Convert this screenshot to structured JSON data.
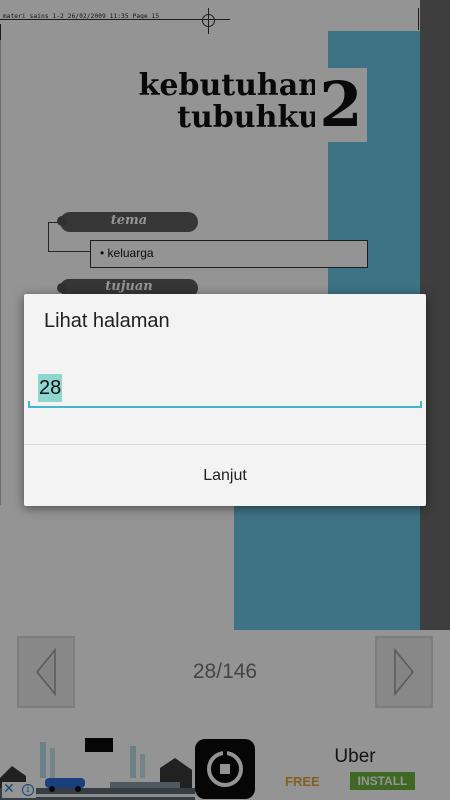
{
  "document": {
    "print_meta": "materi sains 1-2   26/02/2009   11:35   Page 15",
    "title_line1": "kebutuhan",
    "title_line2": "tubuhku",
    "chapter_number": "2",
    "tema_label": "tema",
    "topic_item": "keluarga",
    "tujuan_label": "tujuan",
    "accent_color": "#6cc6e6"
  },
  "navigation": {
    "page_counter": "28/146",
    "prev_icon": "chevron-left-icon",
    "next_icon": "chevron-right-icon"
  },
  "ad": {
    "title": "Uber",
    "free_label": "FREE",
    "install_label": "INSTALL",
    "logo_icon": "uber-logo-icon",
    "close_icon": "close-icon",
    "info_icon": "info-icon",
    "install_color": "#6db33f",
    "free_color": "#e6a43a"
  },
  "dialog": {
    "title": "Lihat halaman",
    "input_value": "28",
    "button_label": "Lanjut",
    "accent_color": "#46b4c9"
  }
}
